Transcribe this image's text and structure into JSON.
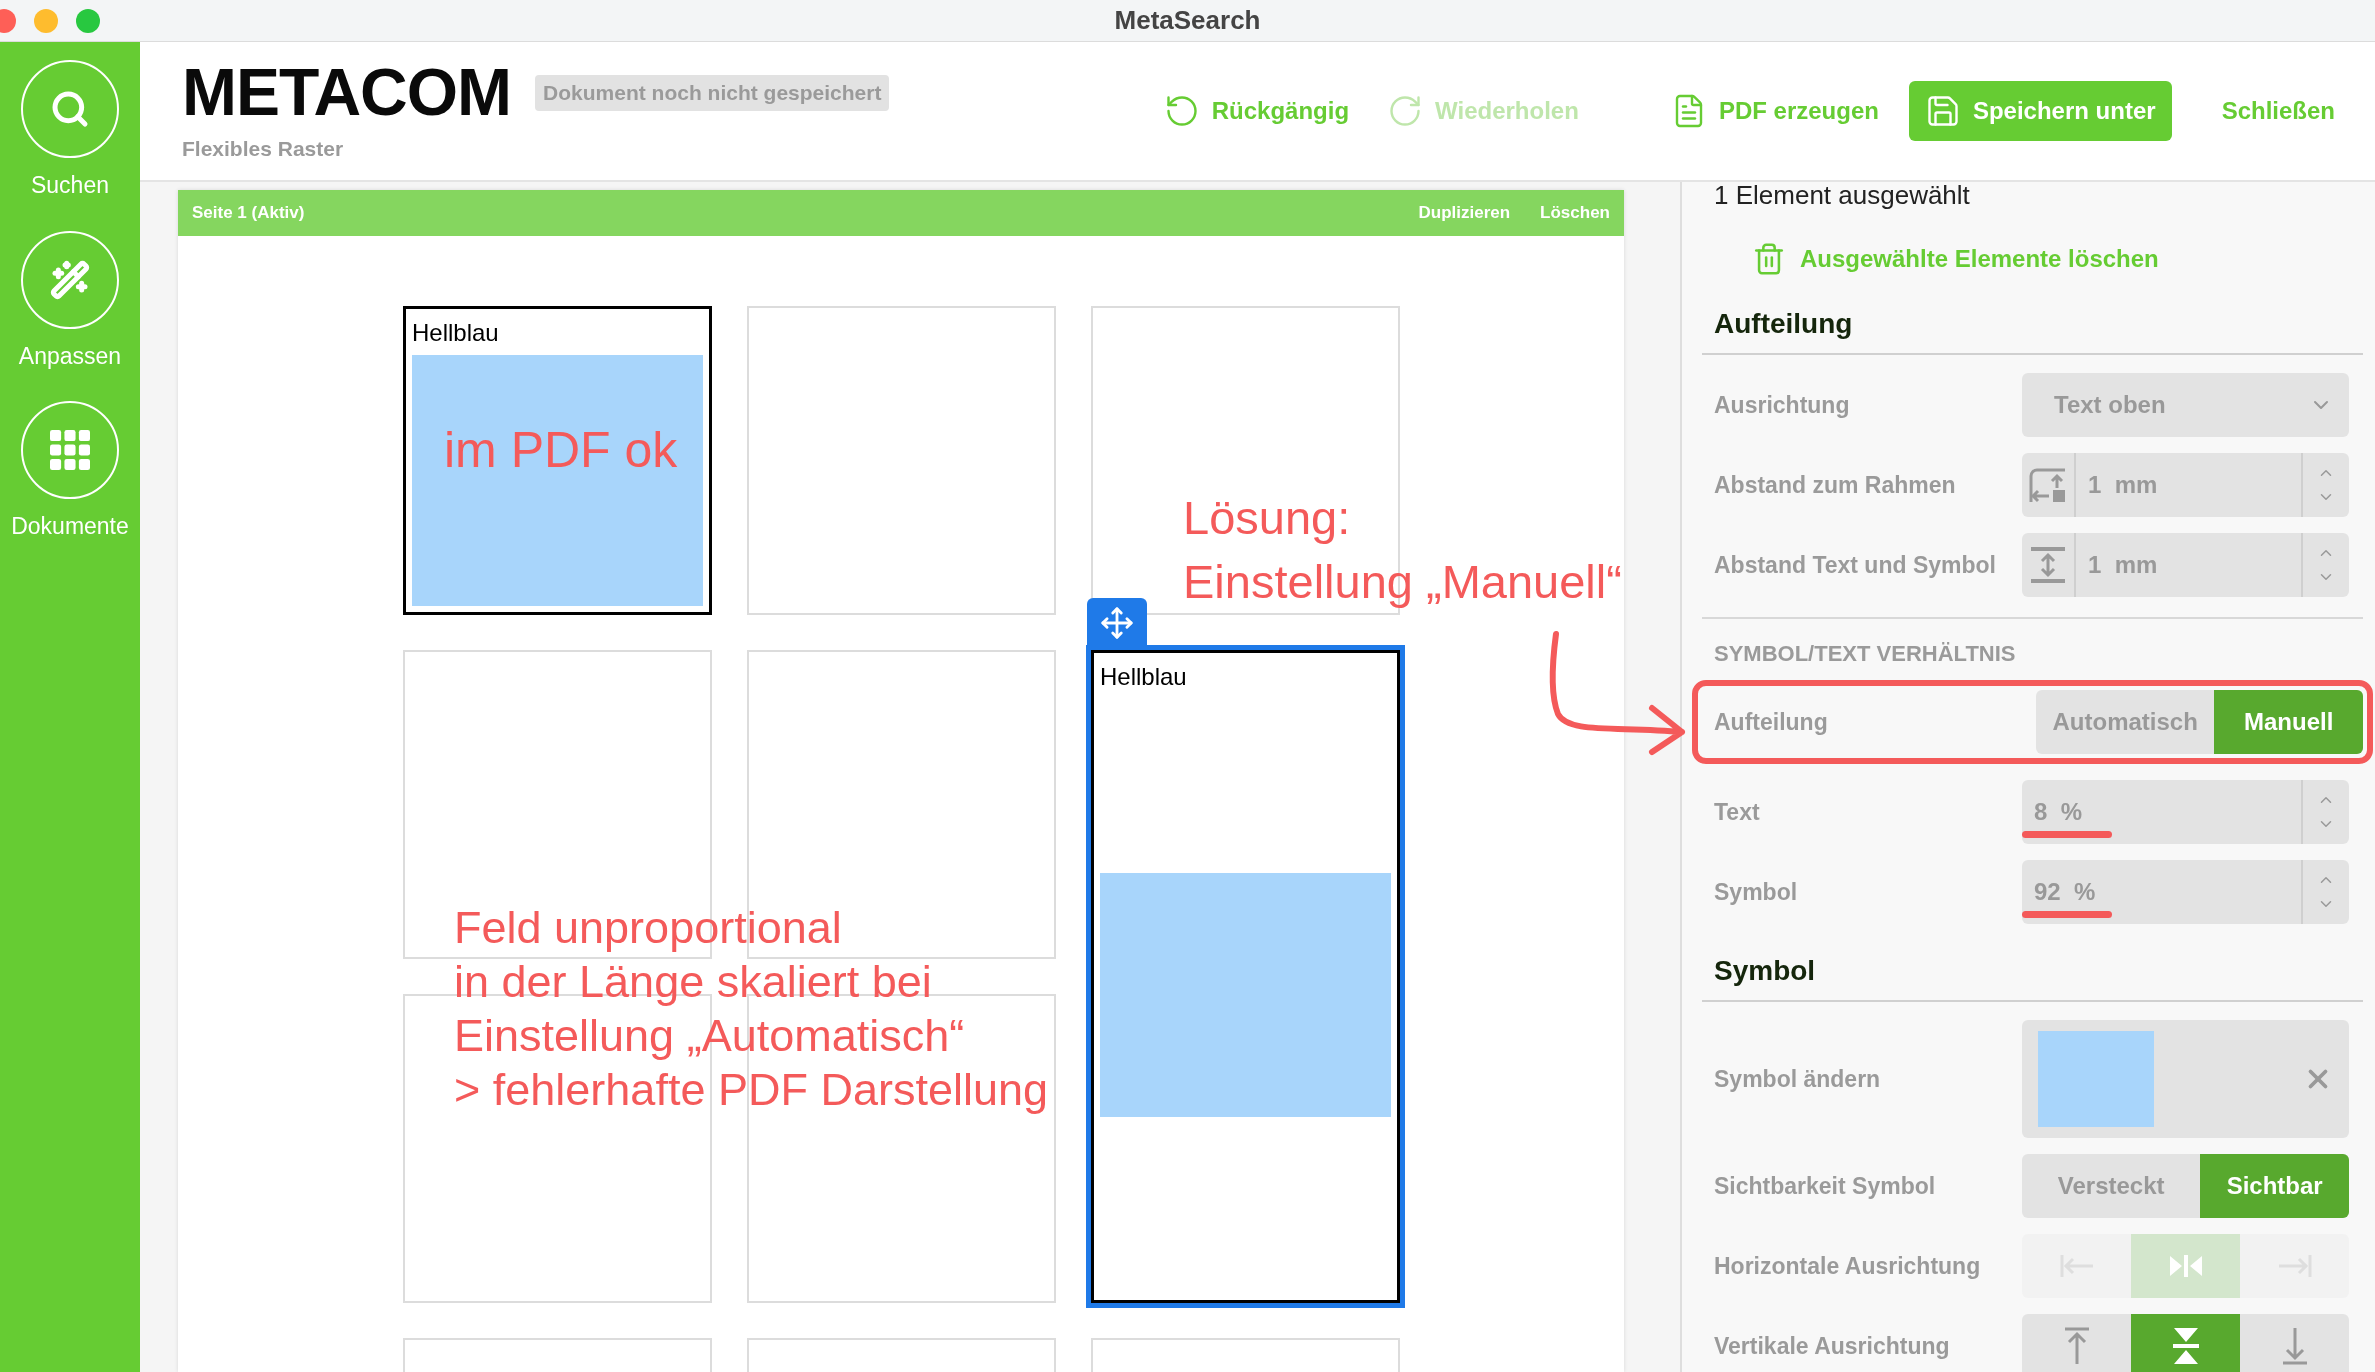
{
  "window": {
    "title": "MetaSearch"
  },
  "sidebar": {
    "items": [
      {
        "label": "Suchen"
      },
      {
        "label": "Anpassen"
      },
      {
        "label": "Dokumente"
      }
    ]
  },
  "header": {
    "logo": "METACOM",
    "save_status": "Dokument noch nicht gespeichert",
    "subtitle": "Flexibles Raster",
    "toolbar": [
      {
        "kind": "undo",
        "label": "Rückgängig",
        "disabled": false
      },
      {
        "kind": "redo",
        "label": "Wiederholen",
        "disabled": true
      },
      {
        "kind": "pdf",
        "label": "PDF erzeugen",
        "disabled": false
      },
      {
        "kind": "save",
        "label": "Speichern unter",
        "disabled": false
      },
      {
        "kind": "close",
        "label": "Schließen",
        "disabled": false
      }
    ]
  },
  "page": {
    "title": "Seite 1 (Aktiv)",
    "actions": [
      "Duplizieren",
      "Löschen"
    ],
    "cells": [
      {
        "kind": "symbol",
        "label": "Hellblau",
        "selected": false
      },
      {
        "kind": "empty",
        "selected": false
      },
      {
        "kind": "empty",
        "selected": false
      },
      {
        "kind": "empty",
        "selected": false
      },
      {
        "kind": "empty",
        "selected": false
      },
      {
        "kind": "tall",
        "label": "Hellblau",
        "selected": true
      },
      {
        "kind": "empty",
        "selected": false
      },
      {
        "kind": "empty",
        "selected": false
      },
      {
        "kind": "empty",
        "selected": false
      },
      {
        "kind": "empty",
        "selected": false
      },
      {
        "kind": "empty",
        "selected": false
      }
    ],
    "annotations": [
      {
        "lines": [
          "im PDF ok"
        ]
      },
      {
        "lines": [
          "Lösung:",
          "Einstellung „Manuell“"
        ]
      },
      {
        "lines": [
          "Feld unproportional",
          "in der Länge skaliert bei",
          "Einstellung „Automatisch“",
          "> fehlerhafte PDF Darstellung"
        ]
      }
    ]
  },
  "panel": {
    "selection": "1 Element ausgewählt",
    "delete_label": "Ausgewählte Elemente löschen",
    "sections": [
      {
        "kind": "heading",
        "title": "Aufteilung",
        "rows": [
          {
            "kind": "select",
            "label": "Ausrichtung",
            "value": "Text oben"
          },
          {
            "kind": "stepper",
            "label": "Abstand zum Rahmen",
            "value": "1",
            "unit": "mm"
          },
          {
            "kind": "stepper",
            "label": "Abstand Text und Symbol",
            "value": "1",
            "unit": "mm"
          }
        ]
      },
      {
        "kind": "caps",
        "title": "SYMBOL/TEXT VERHÄLTNIS",
        "rows": [
          {
            "kind": "toggle",
            "label": "Aufteilung",
            "highlighted": true,
            "options": [
              {
                "label": "Automatisch",
                "selected": false
              },
              {
                "label": "Manuell",
                "selected": true
              }
            ]
          },
          {
            "kind": "stepper",
            "label": "Text",
            "value": "8",
            "unit": "%",
            "underlined": true
          },
          {
            "kind": "stepper",
            "label": "Symbol",
            "value": "92",
            "unit": "%",
            "underlined": true
          }
        ]
      },
      {
        "kind": "heading",
        "title": "Symbol",
        "rows": [
          {
            "kind": "symbol",
            "label": "Symbol ändern"
          },
          {
            "kind": "toggle",
            "label": "Sichtbarkeit Symbol",
            "highlighted": false,
            "options": [
              {
                "label": "Versteckt",
                "selected": false
              },
              {
                "label": "Sichtbar",
                "selected": true
              }
            ]
          },
          {
            "kind": "icons",
            "label": "Horizontale Ausrichtung",
            "disabled": true,
            "options": [
              {
                "selected": false
              },
              {
                "selected": true
              },
              {
                "selected": false
              }
            ]
          },
          {
            "kind": "icons",
            "label": "Vertikale Ausrichtung",
            "disabled": false,
            "options": [
              {
                "selected": false
              },
              {
                "selected": true
              },
              {
                "selected": false
              }
            ]
          }
        ]
      }
    ]
  }
}
